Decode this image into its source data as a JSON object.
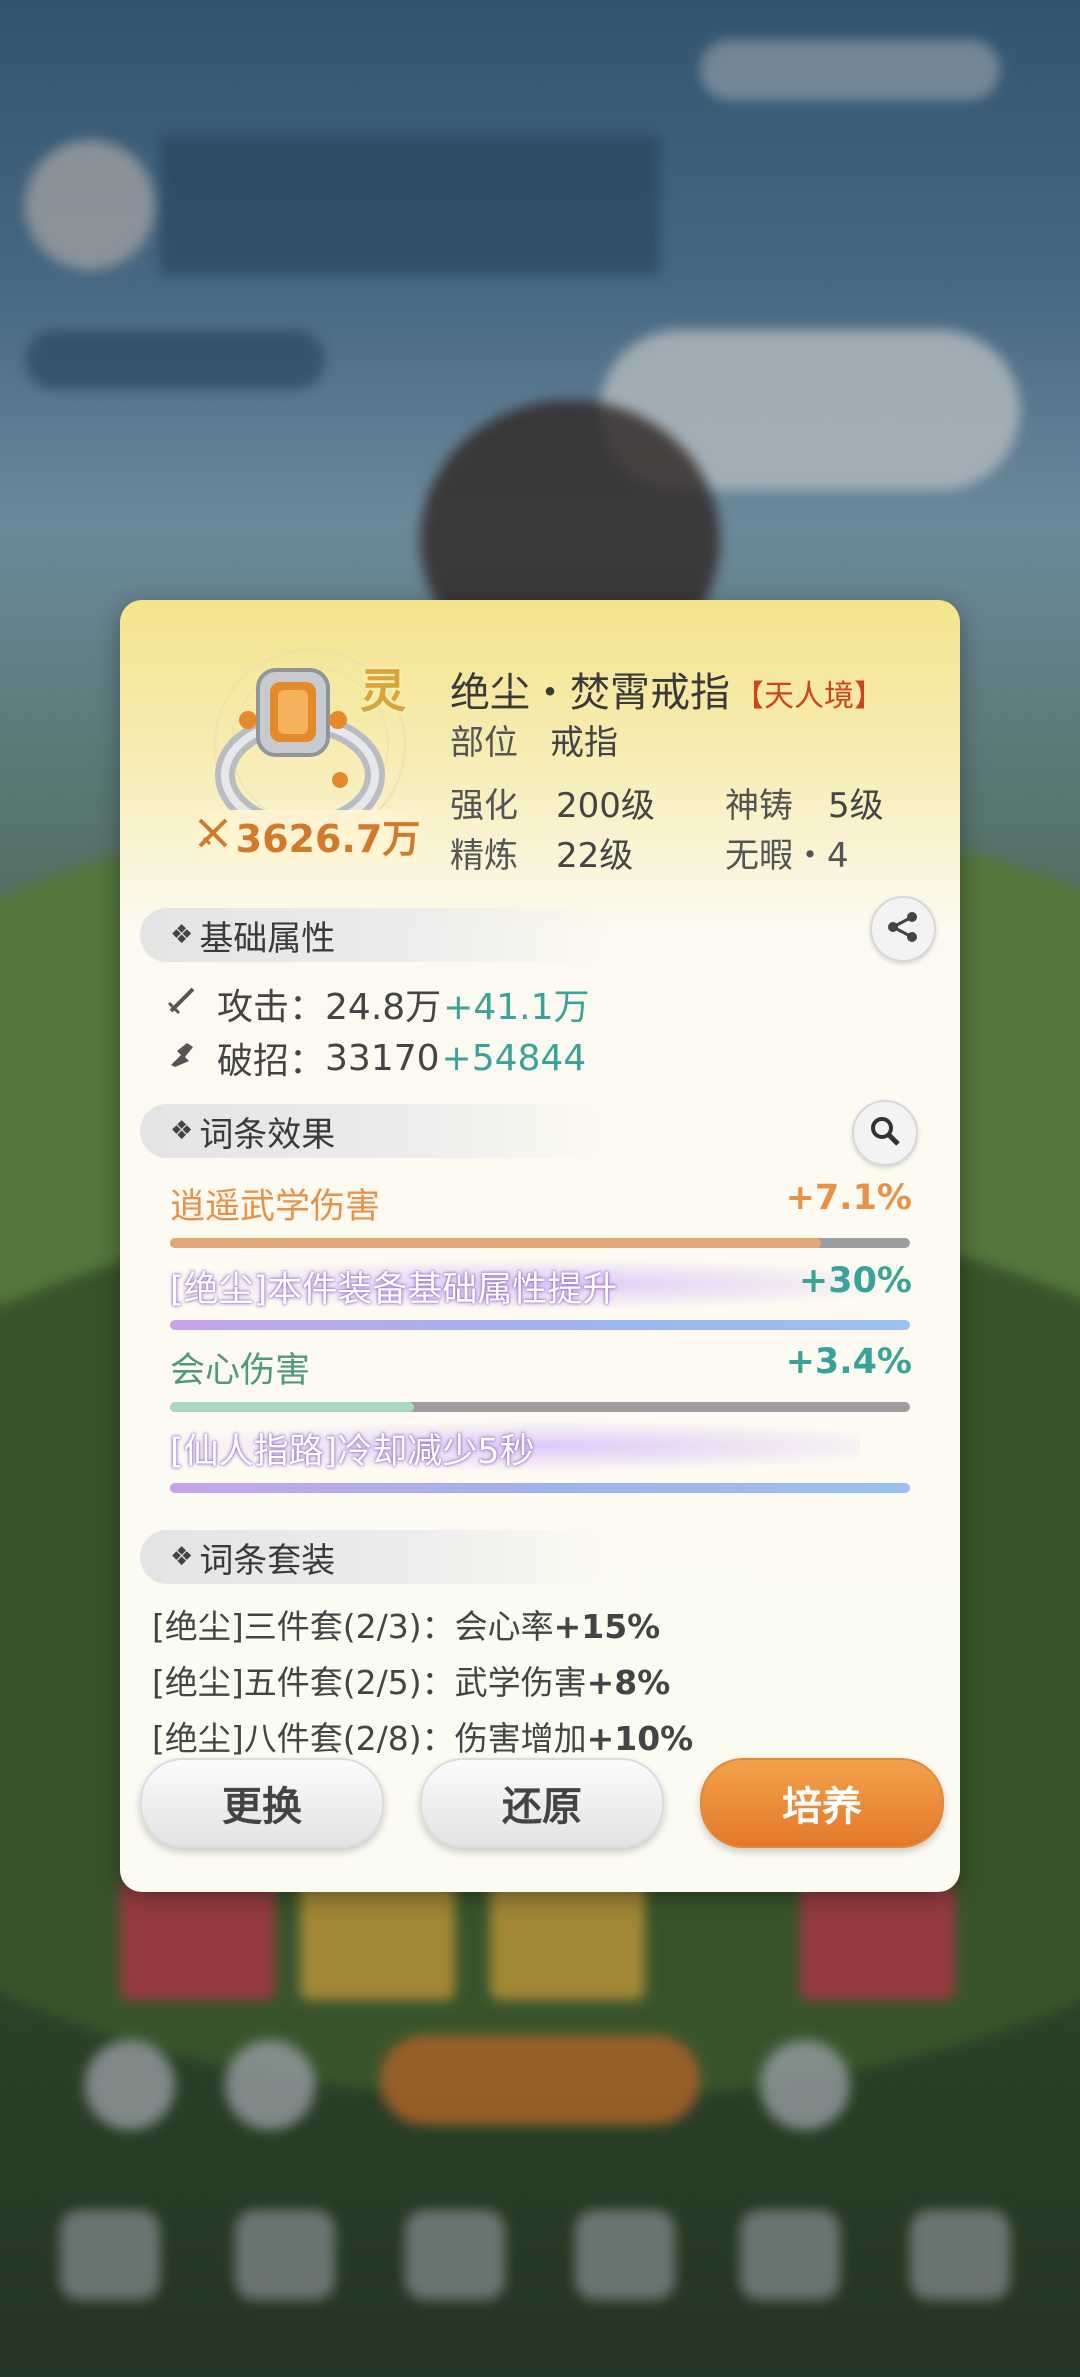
{
  "item": {
    "badge": "灵",
    "power": "3626.7万",
    "name": "绝尘・焚霄戒指",
    "tier": "【天人境】",
    "slot_label": "部位",
    "slot_value": "戒指",
    "enhance_label": "强化",
    "enhance_value": "200级",
    "divine_label": "神铸",
    "divine_value": "5级",
    "refine_label": "精炼",
    "refine_value": "22级",
    "flawless": "无暇・4"
  },
  "base_attrs": {
    "title": "基础属性",
    "rows": [
      {
        "icon": "sword-icon",
        "label": "攻击：",
        "base": "24.8万",
        "bonus": "+41.1万"
      },
      {
        "icon": "break-icon",
        "label": "破招：",
        "base": "33170",
        "bonus": "+54844"
      }
    ]
  },
  "affixes": {
    "title": "词条效果",
    "rows": [
      {
        "label": "逍遥武学伤害",
        "value": "+7.1%",
        "progress": 0.88,
        "color": "#e89248",
        "bar_color": "#e3a878"
      },
      {
        "label": "[绝尘]本件装备基础属性提升",
        "value": "+30%",
        "progress": 1.0,
        "color": "#ffffff",
        "bar_color": "#b3b6f2"
      },
      {
        "label": "会心伤害",
        "value": "+3.4%",
        "progress": 0.33,
        "color": "#4f9a7c",
        "bar_color": "#a8d8c2"
      },
      {
        "label": "[仙人指路]冷却减少5秒",
        "value": "",
        "progress": 1.0,
        "color": "#ffffff",
        "bar_color": "#b3b6f2"
      }
    ]
  },
  "set": {
    "title": "词条套装",
    "rows": [
      {
        "name": "[绝尘]三件套(2/3)：",
        "effect": "会心率",
        "bonus": "+15%"
      },
      {
        "name": "[绝尘]五件套(2/5)：",
        "effect": "武学伤害",
        "bonus": "+8%"
      },
      {
        "name": "[绝尘]八件套(2/8)：",
        "effect": "伤害增加",
        "bonus": "+10%"
      }
    ]
  },
  "buttons": {
    "replace": "更换",
    "restore": "还原",
    "cultivate": "培养"
  },
  "colors": {
    "accent_orange": "#e4782a",
    "bonus_green": "#3aa397",
    "tier_red": "#d2421e"
  }
}
